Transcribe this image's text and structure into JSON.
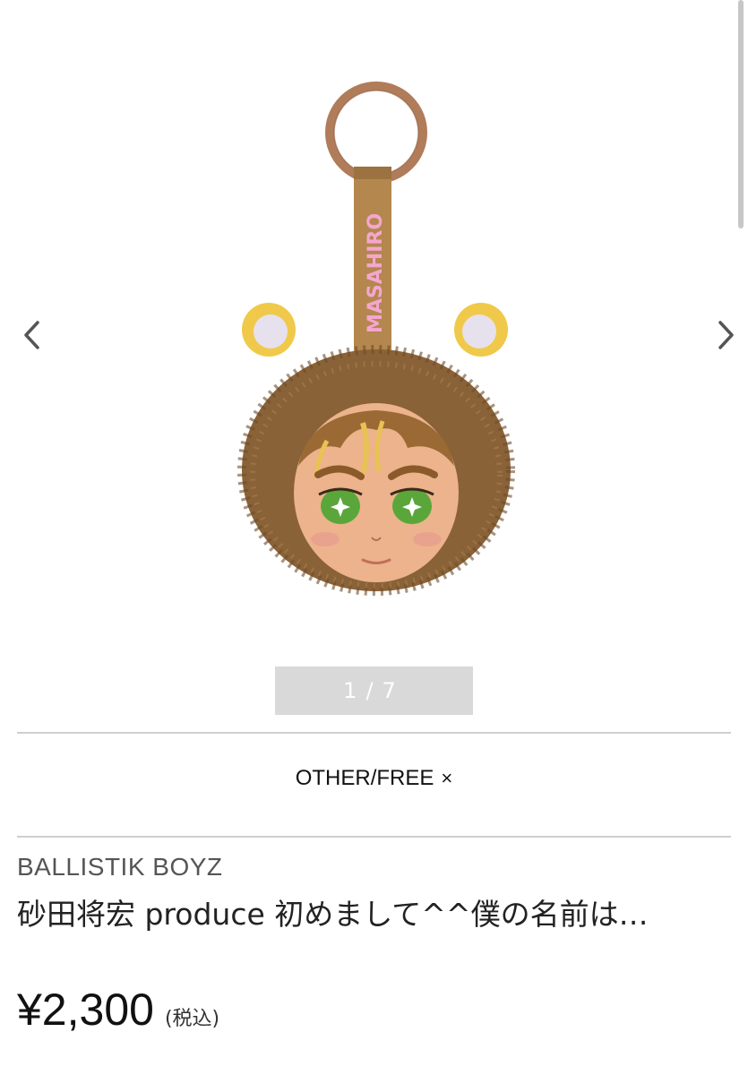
{
  "gallery": {
    "image_alt": "MASAHIRO lion fur keychain",
    "strap_text": "MASAHIRO",
    "pager": {
      "current": "1",
      "separator": "/",
      "total": "7"
    }
  },
  "variant": {
    "label": "OTHER/FREE",
    "remove_symbol": "×"
  },
  "product": {
    "brand": "BALLISTIK BOYZ",
    "title": "砂田将宏 produce 初めまして^^僕の名前は…",
    "price": "¥2,300",
    "tax_note": "(税込)"
  },
  "colors": {
    "accent_pink": "#f5a6cf",
    "strap_brown": "#b3874e",
    "ring_copper": "#b07c5a",
    "fur_brown": "#8a6238",
    "pager_bg": "#d9d9d9"
  }
}
